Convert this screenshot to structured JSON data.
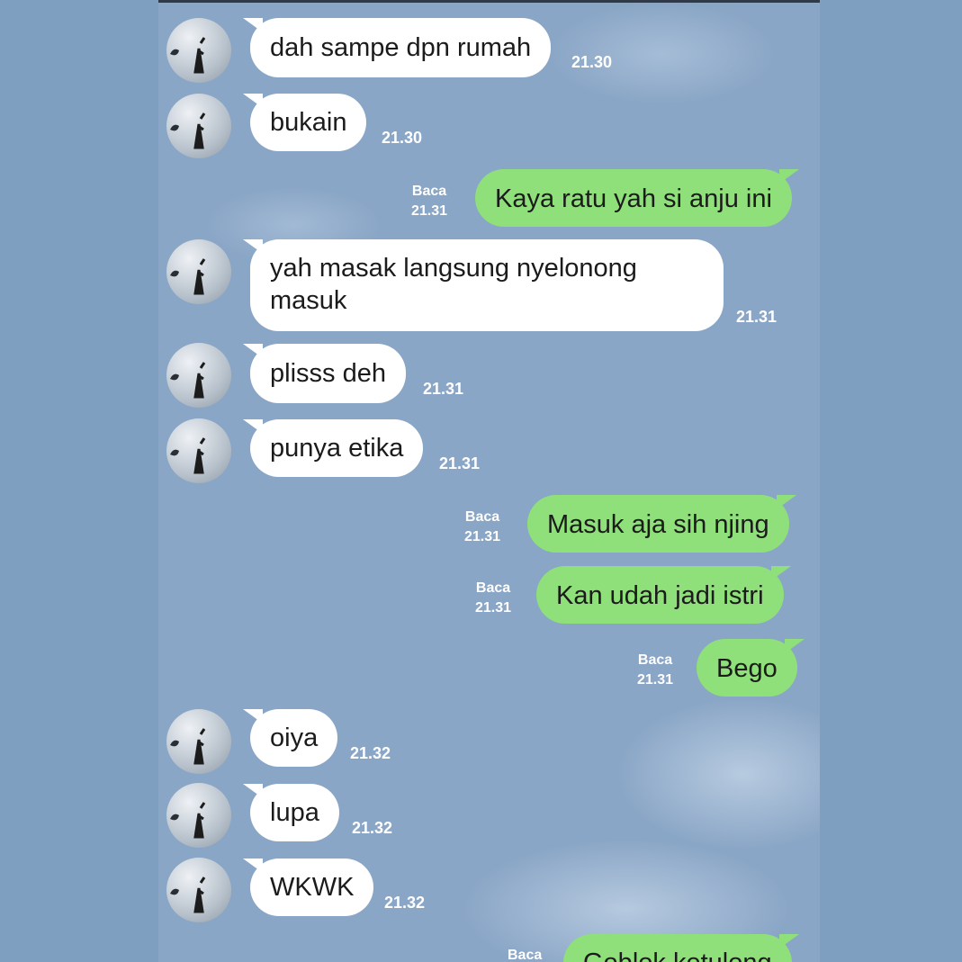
{
  "messages": [
    {
      "text": "dah sampe dpn rumah",
      "time": "21.30"
    },
    {
      "text": "bukain",
      "time": "21.30"
    },
    {
      "text": "Kaya ratu yah si anju ini",
      "read": "Baca",
      "time": "21.31"
    },
    {
      "text": "yah masak langsung nyelonong masuk",
      "time": "21.31"
    },
    {
      "text": "plisss deh",
      "time": "21.31"
    },
    {
      "text": "punya etika",
      "time": "21.31"
    },
    {
      "text": "Masuk aja sih njing",
      "read": "Baca",
      "time": "21.31"
    },
    {
      "text": "Kan udah jadi istri",
      "read": "Baca",
      "time": "21.31"
    },
    {
      "text": "Bego",
      "read": "Baca",
      "time": "21.31"
    },
    {
      "text": "oiya",
      "time": "21.32"
    },
    {
      "text": "lupa",
      "time": "21.32"
    },
    {
      "text": "WKWK",
      "time": "21.32"
    },
    {
      "text": "Goblok ketulong",
      "read": "Baca",
      "time": ""
    }
  ],
  "colors": {
    "background": "#8aa6c6",
    "incoming_bubble": "#ffffff",
    "outgoing_bubble": "#8fe07a",
    "meta_text": "#ffffff"
  },
  "icons": {
    "avatar": "contact-avatar-icon"
  }
}
